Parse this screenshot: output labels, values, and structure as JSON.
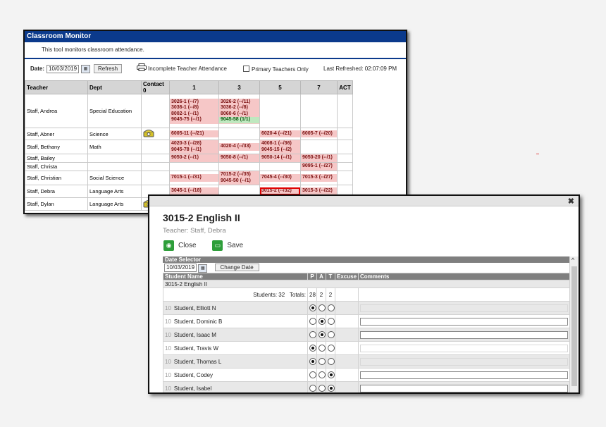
{
  "monitor": {
    "title": "Classroom Monitor",
    "description": "This tool monitors classroom attendance.",
    "date_label": "Date:",
    "date_value": "10/03/2019",
    "refresh_label": "Refresh",
    "incomplete_label": "Incomplete Teacher Attendance",
    "primary_only_label": "Primary Teachers Only",
    "last_refreshed": "Last Refreshed: 02:07:09 PM",
    "columns": [
      "Teacher",
      "Dept",
      "Contact 0",
      "1",
      "3",
      "5",
      "7",
      "ACT"
    ],
    "rows": [
      {
        "teacher": "Staff, Andrea",
        "dept": "Special Education",
        "contact": false,
        "p1": [
          "3026-1 (--/7)",
          "3036-1 (--/8)",
          "8002-1 (--/1)",
          "9045-75 (--/1)"
        ],
        "p3": [
          "3026-2 (--/11)",
          "3036-2 (--/8)",
          "8060-6 (--/1)"
        ],
        "p3_green": "9045-58 (1/1)",
        "p5": [],
        "p7": []
      },
      {
        "teacher": "Staff, Abner",
        "dept": "Science",
        "contact": true,
        "p1": [
          "6005-11 (--/21)"
        ],
        "p3": [],
        "p5": [
          "6020-4 (--/21)"
        ],
        "p7": [
          "6005-7 (--/20)"
        ]
      },
      {
        "teacher": "Staff, Bethany",
        "dept": "Math",
        "contact": false,
        "p1": [
          "4020-3 (--/28)",
          "9045-78 (--/1)"
        ],
        "p3": [
          "4020-4 (--/33)"
        ],
        "p5": [
          "4008-1 (--/36)",
          "9045-15 (--/2)"
        ],
        "p7": []
      },
      {
        "teacher": "Staff, Bailey",
        "dept": "",
        "contact": false,
        "p1": [
          "9050-2 (--/1)"
        ],
        "p3": [
          "9050-8 (--/1)"
        ],
        "p5": [
          "9050-14 (--/1)"
        ],
        "p7": [
          "9050-20 (--/1)"
        ]
      },
      {
        "teacher": "Staff, Christa",
        "dept": "",
        "contact": false,
        "p1": [],
        "p3": [],
        "p5": [],
        "p7": [
          "9095-1 (--/27)"
        ]
      },
      {
        "teacher": "Staff, Christian",
        "dept": "Social Science",
        "contact": false,
        "p1": [
          "7015-1 (--/31)"
        ],
        "p3": [
          "7015-2 (--/35)",
          "9045-50 (--/1)"
        ],
        "p5": [
          "7045-4 (--/30)"
        ],
        "p7": [
          "7015-3 (--/27)"
        ]
      },
      {
        "teacher": "Staff, Debra",
        "dept": "Language Arts",
        "contact": false,
        "p1": [
          "3045-1 (--/18)"
        ],
        "p3": [],
        "p5": [
          "3015-2 (--/32)"
        ],
        "p7": [
          "3015-3 (--/22)"
        ]
      },
      {
        "teacher": "Staff, Dylan",
        "dept": "Language Arts",
        "contact": true,
        "p1": [],
        "p3": [],
        "p5": [],
        "p7": []
      }
    ]
  },
  "dialog": {
    "title": "3015-2 English II",
    "teacher": "Teacher: Staff, Debra",
    "close_label": "Close",
    "save_label": "Save",
    "date_selector_label": "Date Selector",
    "date_value": "10/03/2019",
    "change_date_label": "Change Date",
    "headers": {
      "student": "Student Name",
      "p": "P",
      "a": "A",
      "t": "T",
      "excuse": "Excuse",
      "comments": "Comments"
    },
    "section_label": "3015-2 English II",
    "students_count": "Students: 32",
    "totals_label": "Totals:",
    "totals": {
      "p": "28",
      "a": "2",
      "t": "2"
    },
    "students": [
      {
        "grade": "10",
        "name": "Student, Elliott N",
        "status": "P"
      },
      {
        "grade": "10",
        "name": "Student, Dominic B",
        "status": "A"
      },
      {
        "grade": "10",
        "name": "Student, Isaac M",
        "status": "A"
      },
      {
        "grade": "10",
        "name": "Student, Travis W",
        "status": "P"
      },
      {
        "grade": "10",
        "name": "Student, Thomas L",
        "status": "P"
      },
      {
        "grade": "10",
        "name": "Student, Codey",
        "status": "T"
      },
      {
        "grade": "10",
        "name": "Student, Isabel",
        "status": "T"
      }
    ]
  },
  "colors": {
    "title_bar": "#0b3a8c",
    "pending_cell": "#f6c7c7",
    "complete_cell": "#bfe8bf",
    "selected_outline": "#e00000"
  }
}
